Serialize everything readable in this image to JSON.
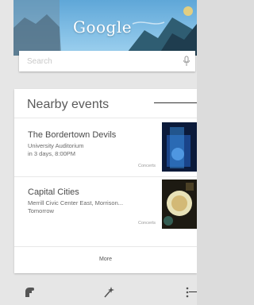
{
  "header": {
    "logo_text": "Google"
  },
  "search": {
    "placeholder": "Search"
  },
  "nearby": {
    "title": "Nearby events",
    "events": [
      {
        "name": "The Bordertown Devils",
        "venue": "University Auditorium",
        "time": "in 3 days, 8:00PM",
        "category": "Concerts"
      },
      {
        "name": "Capital Cities",
        "venue": "Merrill Civic Center East, Morrison...",
        "time": "Tomorrow",
        "category": "Concerts"
      }
    ],
    "more_label": "More"
  },
  "colors": {
    "accent": "#4285f4",
    "card": "#ffffff",
    "background": "#e6e6e6"
  },
  "icons": {
    "bottom_left": "reminders-icon",
    "bottom_center": "magic-wand-icon",
    "bottom_right": "overflow-menu-icon",
    "search_right": "microphone-icon"
  }
}
